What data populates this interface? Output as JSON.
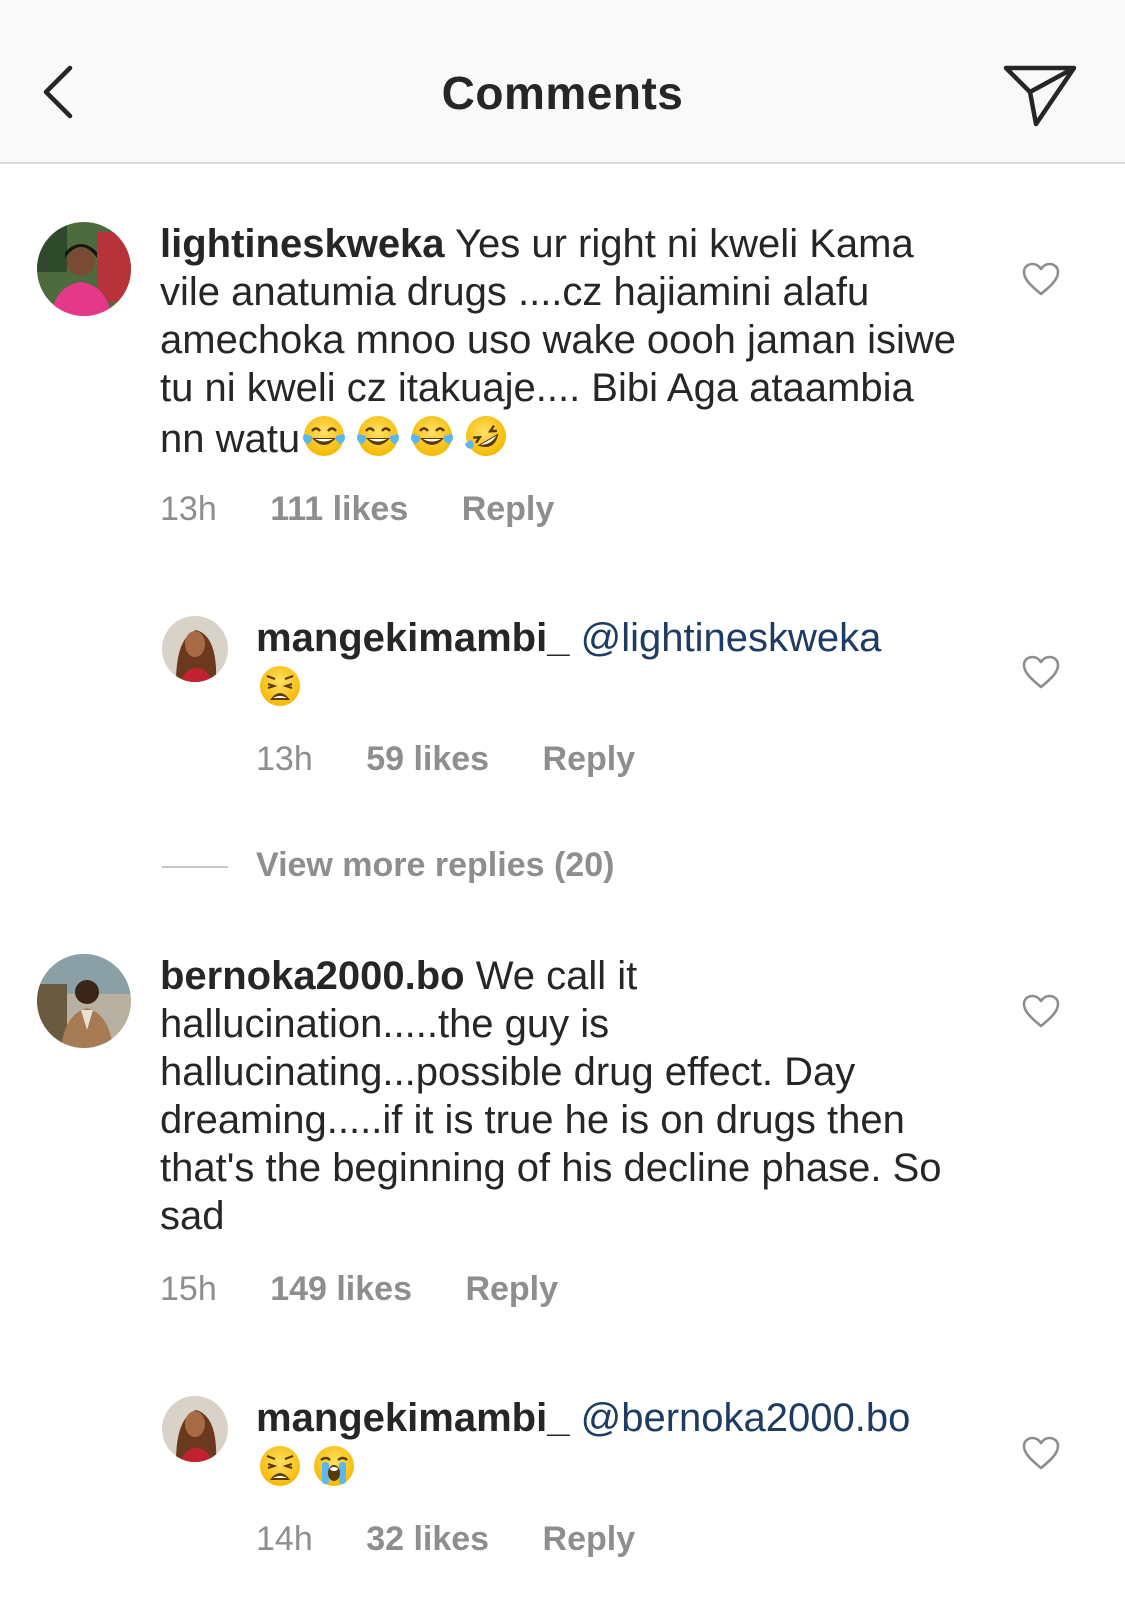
{
  "header": {
    "title": "Comments",
    "back_icon": "chevron-left-icon",
    "share_icon": "paper-plane-icon"
  },
  "colors": {
    "text": "#262626",
    "meta": "#8e8e8e",
    "mention": "#1e3b63",
    "header_bg": "#f9f9f9"
  },
  "comments": [
    {
      "username": "lightineskweka",
      "text": "Yes ur right ni kweli Kama vile anatumia drugs ....cz hajiamini alafu amechoka mnoo uso wake oooh jaman isiwe tu ni kweli cz itakuaje.... Bibi Aga ataambia nn watu",
      "emojis": [
        "tears-of-joy",
        "tears-of-joy",
        "tears-of-joy",
        "rolling-on-floor-laughing"
      ],
      "time": "13h",
      "likes": "111 likes",
      "reply": "Reply"
    },
    {
      "username": "mangekimambi_",
      "mention": "@lightineskweka",
      "emojis": [
        "weary-face"
      ],
      "time": "13h",
      "likes": "59 likes",
      "reply": "Reply"
    },
    {
      "username": "bernoka2000.bo",
      "text": "We call it hallucination.....the guy is hallucinating...possible drug effect. Day dreaming.....if it is true he is on drugs then that's the beginning of his decline phase. So sad",
      "time": "15h",
      "likes": "149 likes",
      "reply": "Reply"
    },
    {
      "username": "mangekimambi_",
      "mention": "@bernoka2000.bo",
      "emojis": [
        "weary-face",
        "loudly-crying-face"
      ],
      "time": "14h",
      "likes": "32 likes",
      "reply": "Reply"
    }
  ],
  "view_more": "View more replies (20)"
}
